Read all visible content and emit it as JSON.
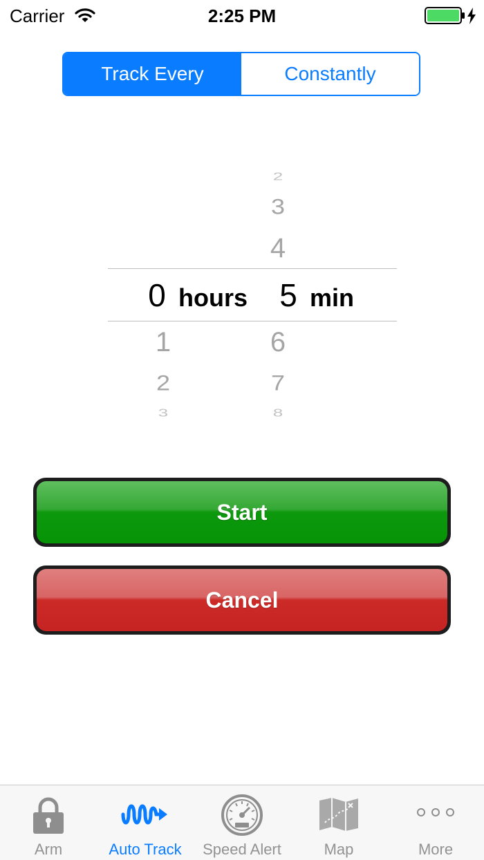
{
  "status_bar": {
    "carrier": "Carrier",
    "time": "2:25 PM",
    "wifi_icon": "wifi-icon",
    "battery_icon": "battery-charging-icon",
    "battery_color": "#4cd964"
  },
  "mode_selector": {
    "segments": [
      {
        "label": "Track Every",
        "selected": true
      },
      {
        "label": "Constantly",
        "selected": false
      }
    ],
    "accent": "#0a7cff"
  },
  "time_picker": {
    "hours": {
      "above": [],
      "selected": "0",
      "below": [
        "1",
        "2",
        "3"
      ],
      "unit": "hours"
    },
    "minutes": {
      "above": [
        "2",
        "3",
        "4"
      ],
      "selected": "5",
      "below": [
        "6",
        "7",
        "8"
      ],
      "unit": "min"
    }
  },
  "buttons": {
    "start_label": "Start",
    "start_color": "#069406",
    "cancel_label": "Cancel",
    "cancel_color": "#c62423"
  },
  "tab_bar": {
    "items": [
      {
        "label": "Arm",
        "icon": "lock-icon",
        "active": false
      },
      {
        "label": "Auto Track",
        "icon": "auto-track-icon",
        "active": true
      },
      {
        "label": "Speed Alert",
        "icon": "speedometer-icon",
        "active": false
      },
      {
        "label": "Map",
        "icon": "map-icon",
        "active": false
      },
      {
        "label": "More",
        "icon": "more-icon",
        "active": false
      }
    ]
  }
}
